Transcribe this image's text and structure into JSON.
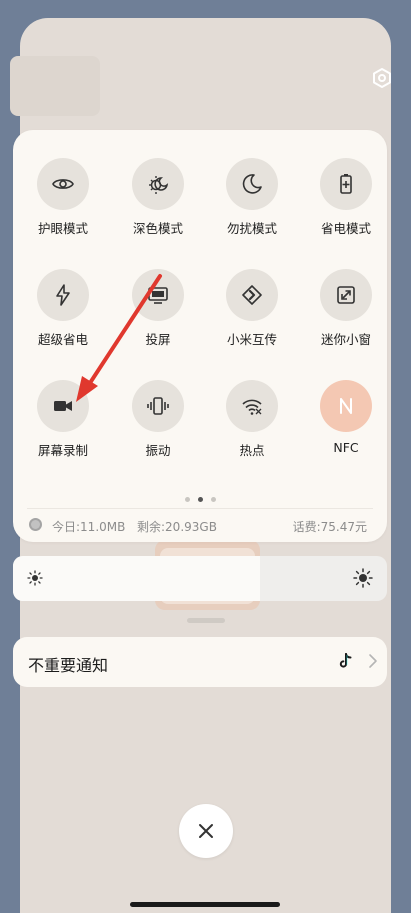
{
  "quick_settings": {
    "tiles": [
      {
        "label": "护眼模式",
        "icon": "eye-icon"
      },
      {
        "label": "深色模式",
        "icon": "dark-mode-icon"
      },
      {
        "label": "勿扰模式",
        "icon": "moon-icon"
      },
      {
        "label": "省电模式",
        "icon": "battery-icon"
      },
      {
        "label": "超级省电",
        "icon": "lightning-icon"
      },
      {
        "label": "投屏",
        "icon": "cast-icon"
      },
      {
        "label": "小米互传",
        "icon": "share-icon"
      },
      {
        "label": "迷你小窗",
        "icon": "mini-window-icon"
      },
      {
        "label": "屏幕录制",
        "icon": "video-camera-icon"
      },
      {
        "label": "振动",
        "icon": "vibrate-icon"
      },
      {
        "label": "热点",
        "icon": "hotspot-icon"
      },
      {
        "label": "NFC",
        "icon": "nfc-icon",
        "active": true
      }
    ],
    "page_count": 3,
    "current_page": 2,
    "status": {
      "today": "今日:11.0MB",
      "remaining": "剩余:20.93GB",
      "fee": "话费:75.47元"
    }
  },
  "brightness": {
    "level": 0.66
  },
  "notification": {
    "title": "不重要通知",
    "app_icon": "tiktok-icon"
  },
  "colors": {
    "active_tile": "#f4c8b3",
    "arrow": "#e0382e",
    "panel": "#fbf8f3"
  }
}
